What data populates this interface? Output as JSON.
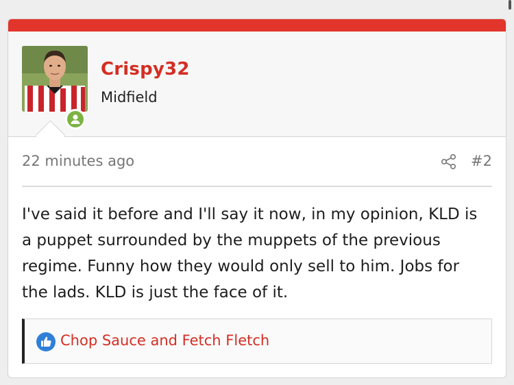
{
  "post": {
    "accent_color": "#e2352b",
    "author": {
      "username": "Crispy32",
      "user_title": "Midfield",
      "status": "online"
    },
    "time": "22 minutes ago",
    "post_number": "#2",
    "body": "I've said it before and I'll say it now, in my opinion, KLD is a puppet surrounded by the muppets of the previous regime. Funny how they would only sell to him. Jobs for the lads. KLD is just the face of it.",
    "reactions": {
      "icon": "thumbs-up-icon",
      "names": "Chop Sauce and Fetch Fletch"
    }
  }
}
